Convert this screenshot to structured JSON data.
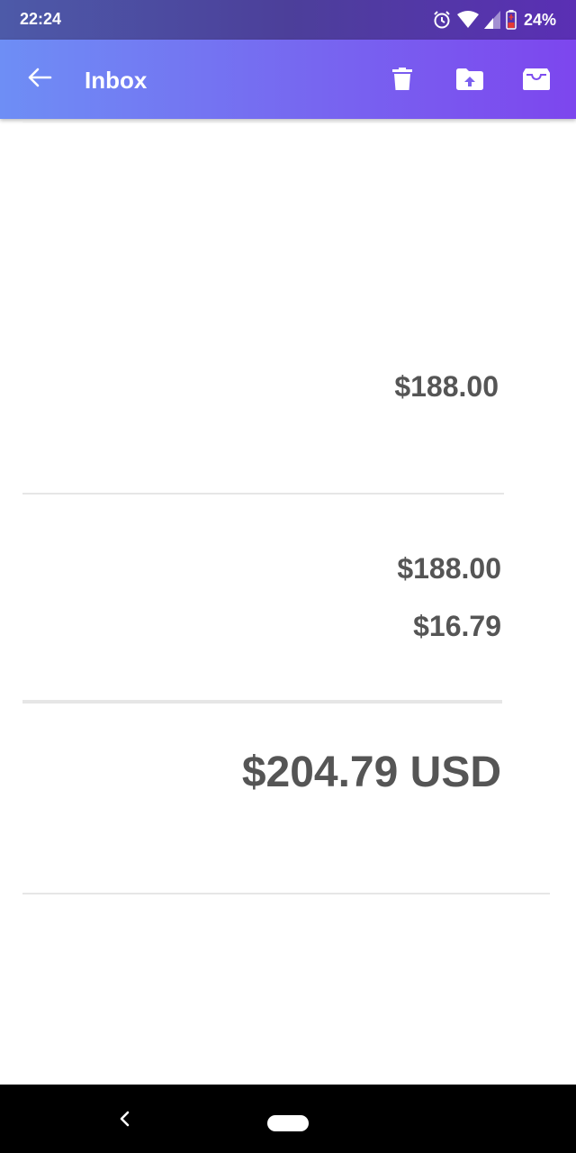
{
  "status_bar": {
    "time": "22:24",
    "battery_percent": "24%",
    "icons": [
      "alarm-icon",
      "wifi-icon",
      "cell-signal-icon",
      "battery-icon"
    ]
  },
  "app_bar": {
    "title": "Inbox",
    "actions": [
      "delete-icon",
      "move-to-folder-icon",
      "archive-icon"
    ]
  },
  "receipt": {
    "item_price": "$188.00",
    "subtotal": "$188.00",
    "tax": "$16.79",
    "total": "$204.79 USD"
  },
  "colors": {
    "app_bar_start": "#6e8ef5",
    "app_bar_end": "#7d46ee",
    "amount_text": "#555555",
    "divider": "#e6e6e6"
  }
}
